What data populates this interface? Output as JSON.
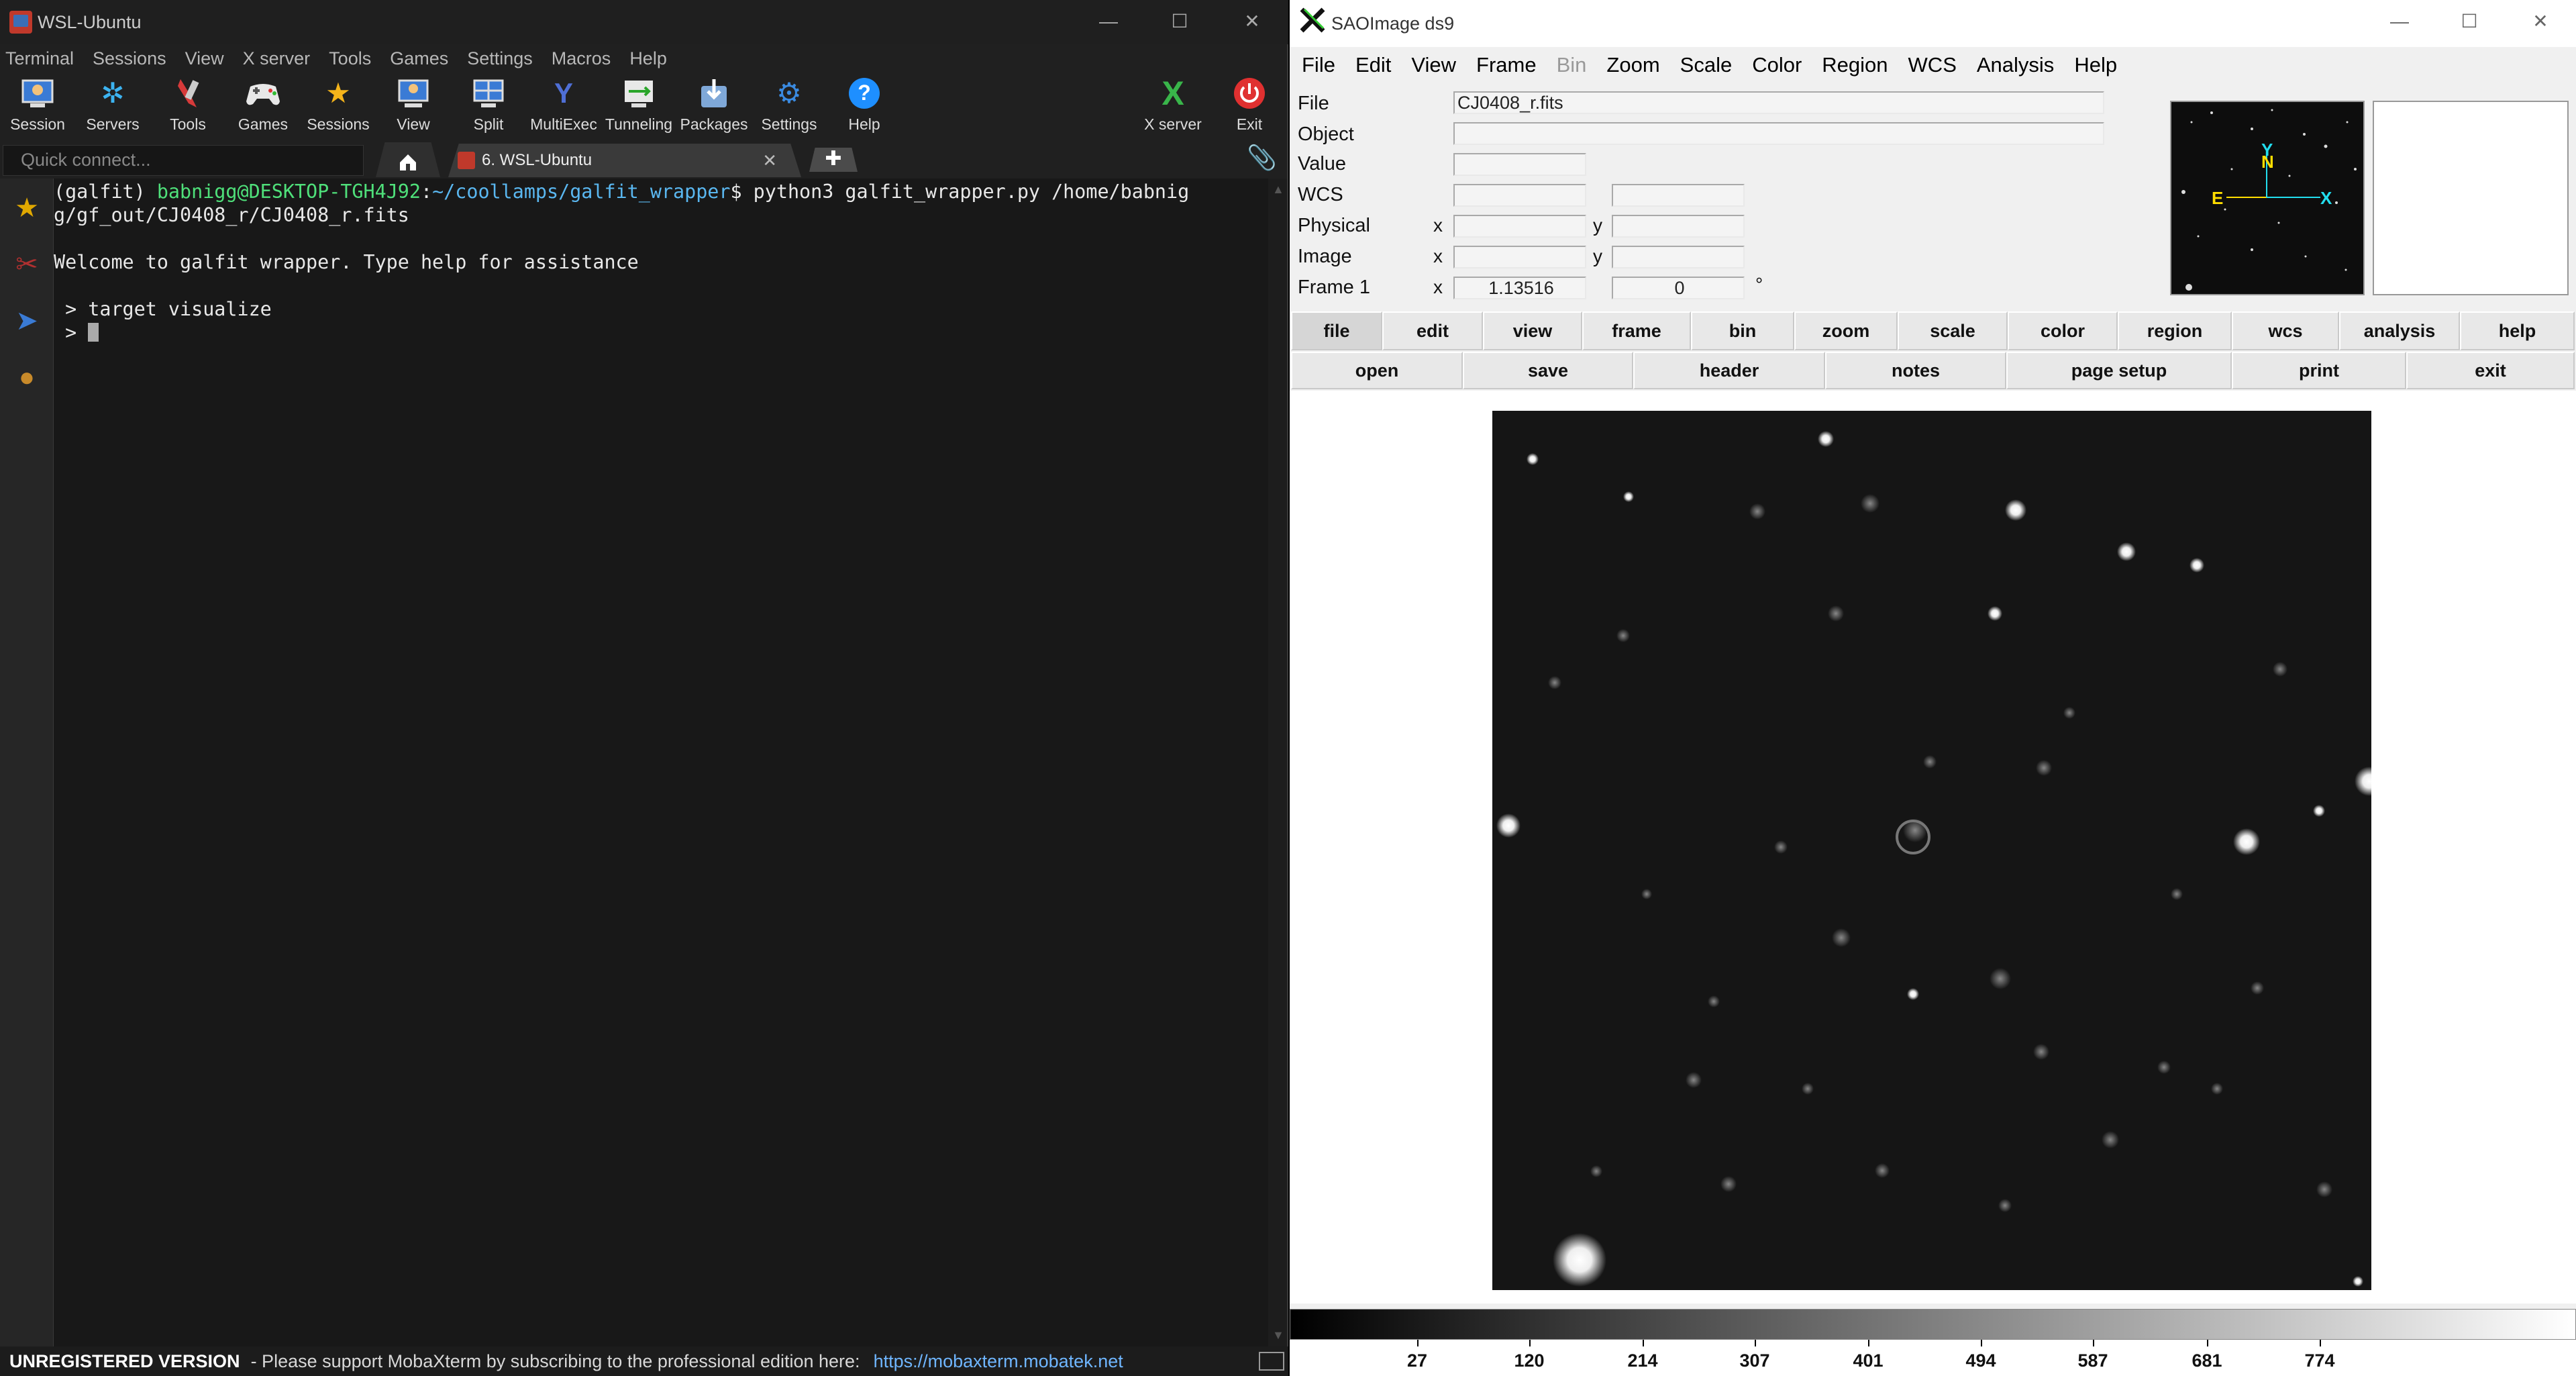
{
  "moba": {
    "title": "WSL-Ubuntu",
    "menu": [
      "Terminal",
      "Sessions",
      "View",
      "X server",
      "Tools",
      "Games",
      "Settings",
      "Macros",
      "Help"
    ],
    "toolbar": [
      {
        "label": "Session",
        "icon": "session-icon"
      },
      {
        "label": "Servers",
        "icon": "servers-icon"
      },
      {
        "label": "Tools",
        "icon": "tools-icon"
      },
      {
        "label": "Games",
        "icon": "games-icon"
      },
      {
        "label": "Sessions",
        "icon": "sessions-star-icon"
      },
      {
        "label": "View",
        "icon": "view-icon"
      },
      {
        "label": "Split",
        "icon": "split-icon"
      },
      {
        "label": "MultiExec",
        "icon": "multiexec-icon"
      },
      {
        "label": "Tunneling",
        "icon": "tunneling-icon"
      },
      {
        "label": "Packages",
        "icon": "packages-icon"
      },
      {
        "label": "Settings",
        "icon": "settings-icon"
      },
      {
        "label": "Help",
        "icon": "help-icon"
      }
    ],
    "xserver_label": "X server",
    "exit_label": "Exit",
    "quick_connect_placeholder": "Quick connect...",
    "session_tab": "6. WSL-Ubuntu",
    "terminal": {
      "line1_env": "(galfit) ",
      "line1_user": "babnigg@DESKTOP-TGH4J92",
      "line1_sep": ":",
      "line1_path": "~/coollamps/galfit_wrapper",
      "line1_cmd": "$ python3 galfit_wrapper.py /home/babnig",
      "line2": "g/gf_out/CJ0408_r/CJ0408_r.fits",
      "line3": "",
      "line4": "Welcome to galfit wrapper. Type help for assistance",
      "line5": "",
      "line6": " > target visualize",
      "line7": " > "
    },
    "status": {
      "unregistered": "UNREGISTERED VERSION",
      "message": " -  Please support MobaXterm by subscribing to the professional edition here:",
      "link": "https://mobaxterm.mobatek.net"
    }
  },
  "ds9": {
    "title": "SAOImage ds9",
    "menu": [
      "File",
      "Edit",
      "View",
      "Frame",
      "Bin",
      "Zoom",
      "Scale",
      "Color",
      "Region",
      "WCS",
      "Analysis",
      "Help"
    ],
    "info": {
      "file_label": "File",
      "file_value": "CJ0408_r.fits",
      "object_label": "Object",
      "value_label": "Value",
      "wcs_label": "WCS",
      "physical_label": "Physical",
      "image_label": "Image",
      "frame_label": "Frame 1",
      "x": "x",
      "y": "y",
      "frame_x": "1.13516",
      "frame_y": "0",
      "degree": "°"
    },
    "panner": {
      "n": "N",
      "e": "E",
      "x": "X",
      "y": "Y"
    },
    "buttons_top": [
      "file",
      "edit",
      "view",
      "frame",
      "bin",
      "zoom",
      "scale",
      "color",
      "region",
      "wcs",
      "analysis",
      "help"
    ],
    "buttons_bottom": [
      "open",
      "save",
      "header",
      "notes",
      "page setup",
      "print",
      "exit"
    ],
    "colorbar_ticks": [
      "27",
      "120",
      "214",
      "307",
      "401",
      "494",
      "587",
      "681",
      "774"
    ]
  }
}
